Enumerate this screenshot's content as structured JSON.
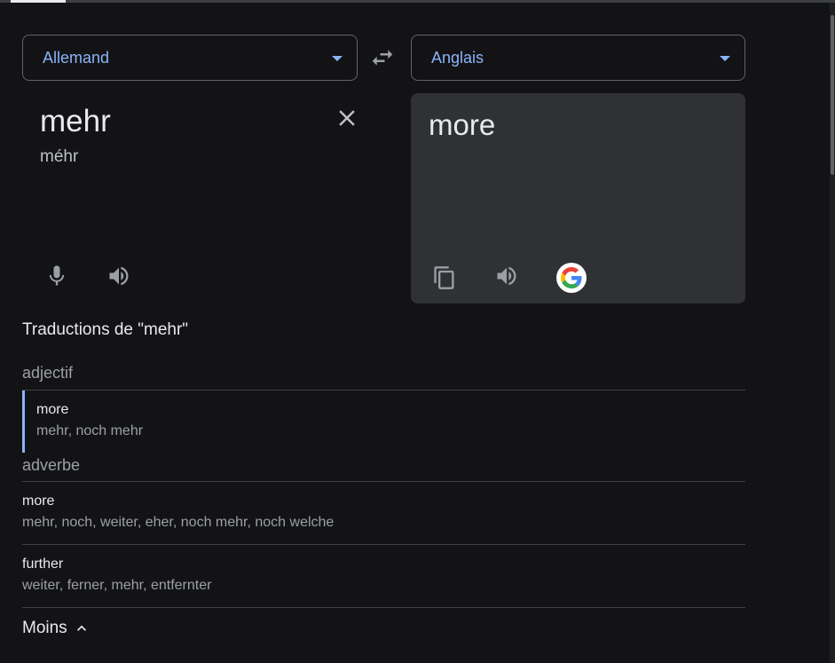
{
  "languages": {
    "source": "Allemand",
    "target": "Anglais"
  },
  "source": {
    "text": "mehr",
    "transliteration": "méhr"
  },
  "target": {
    "text": "more"
  },
  "translations": {
    "title": "Traductions de \"mehr\"",
    "groups": [
      {
        "pos": "adjectif",
        "entries": [
          {
            "word": "more",
            "synonyms": "mehr, noch mehr"
          }
        ]
      },
      {
        "pos": "adverbe",
        "entries": [
          {
            "word": "more",
            "synonyms": "mehr, noch, weiter, eher, noch mehr, noch welche"
          },
          {
            "word": "further",
            "synonyms": "weiter, ferner, mehr, entfernter"
          }
        ]
      }
    ],
    "less_label": "Moins"
  },
  "colors": {
    "accent": "#8ab4f8",
    "background": "#131316",
    "panel": "#303134"
  },
  "icons": [
    "chevron-down-icon",
    "swap-icon",
    "close-icon",
    "microphone-icon",
    "speaker-icon",
    "copy-icon",
    "google-logo-icon",
    "chevron-up-icon"
  ]
}
